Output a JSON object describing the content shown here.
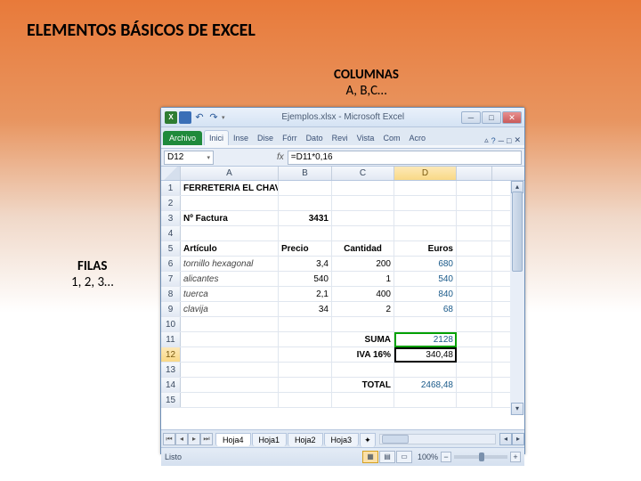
{
  "slide": {
    "title": "ELEMENTOS BÁSICOS DE EXCEL",
    "columns_label": "COLUMNAS",
    "columns_sub": "A, B,C…",
    "rows_label": "FILAS",
    "rows_sub": "1, 2, 3…"
  },
  "window": {
    "title": "Ejemplos.xlsx - Microsoft Excel",
    "file_tab": "Archivo",
    "tabs": [
      "Inici",
      "Inse",
      "Dise",
      "Fórr",
      "Dato",
      "Revi",
      "Vista",
      "Com",
      "Acro"
    ],
    "name_box": "D12",
    "formula": "=D11*0,16",
    "columns": [
      "A",
      "B",
      "C",
      "D"
    ],
    "status": "Listo",
    "zoom": "100%",
    "sheets": [
      "Hoja4",
      "Hoja1",
      "Hoja2",
      "Hoja3"
    ]
  },
  "sheet": {
    "rows": [
      {
        "n": "1",
        "A": "FERRETERIA EL CHAVO",
        "B": "",
        "C": "",
        "D": "",
        "bold": true
      },
      {
        "n": "2",
        "A": "",
        "B": "",
        "C": "",
        "D": ""
      },
      {
        "n": "3",
        "A": "Nº Factura",
        "B": "3431",
        "C": "",
        "D": "",
        "bold": true
      },
      {
        "n": "4",
        "A": "",
        "B": "",
        "C": "",
        "D": ""
      },
      {
        "n": "5",
        "A": "Artículo",
        "B": "Precio",
        "C": "Cantidad",
        "D": "Euros",
        "bold": true
      },
      {
        "n": "6",
        "A": "tornillo hexagonal",
        "B": "3,4",
        "C": "200",
        "D": "680",
        "italic": true,
        "dform": true
      },
      {
        "n": "7",
        "A": "alicantes",
        "B": "540",
        "C": "1",
        "D": "540",
        "italic": true,
        "dform": true
      },
      {
        "n": "8",
        "A": "tuerca",
        "B": "2,1",
        "C": "400",
        "D": "840",
        "italic": true,
        "dform": true
      },
      {
        "n": "9",
        "A": "clavija",
        "B": "34",
        "C": "2",
        "D": "68",
        "italic": true,
        "dform": true
      },
      {
        "n": "10",
        "A": "",
        "B": "",
        "C": "",
        "D": ""
      },
      {
        "n": "11",
        "A": "",
        "B": "",
        "C": "SUMA",
        "D": "2128",
        "cright": true,
        "dform": true
      },
      {
        "n": "12",
        "A": "",
        "B": "",
        "C": "IVA 16%",
        "D": "340,48",
        "cright": true,
        "selected": true
      },
      {
        "n": "13",
        "A": "",
        "B": "",
        "C": "",
        "D": ""
      },
      {
        "n": "14",
        "A": "",
        "B": "",
        "C": "TOTAL",
        "D": "2468,48",
        "cright": true,
        "dform": true
      },
      {
        "n": "15",
        "A": "",
        "B": "",
        "C": "",
        "D": ""
      }
    ]
  }
}
